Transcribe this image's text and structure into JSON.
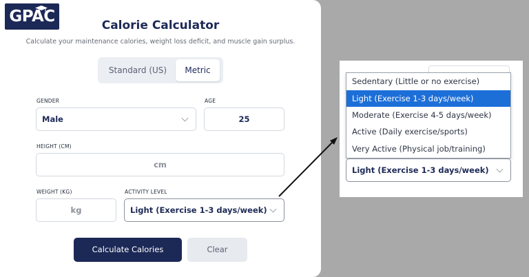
{
  "logo": {
    "text": "GPAC"
  },
  "header": {
    "title": "Calorie Calculator",
    "subtitle": "Calculate your maintenance calories, weight loss deficit, and muscle gain surplus."
  },
  "units": {
    "options": [
      "Standard (US)",
      "Metric"
    ],
    "selected": "Metric"
  },
  "form": {
    "gender": {
      "label": "GENDER",
      "value": "Male"
    },
    "age": {
      "label": "AGE",
      "value": "25"
    },
    "height": {
      "label": "HEIGHT (CM)",
      "placeholder": "cm"
    },
    "weight": {
      "label": "WEIGHT (KG)",
      "placeholder": "kg"
    },
    "activity": {
      "label": "ACTIVITY LEVEL",
      "value": "Light (Exercise 1-3 days/week)"
    }
  },
  "buttons": {
    "calculate": "Calculate Calories",
    "clear": "Clear"
  },
  "activity_dropdown": {
    "options": [
      "Sedentary (Little or no exercise)",
      "Light (Exercise 1-3 days/week)",
      "Moderate (Exercise 4-5 days/week)",
      "Active (Daily exercise/sports)",
      "Very Active (Physical job/training)"
    ],
    "selected_index": 1,
    "selected_value": "Light (Exercise 1-3 days/week)"
  },
  "colors": {
    "brand_navy": "#1c2957",
    "highlight_blue": "#1d6fd8",
    "background_gray": "#a9a9a9"
  },
  "icons": [
    "graduation-cap-icon",
    "chevron-down-icon",
    "arrow-icon"
  ]
}
